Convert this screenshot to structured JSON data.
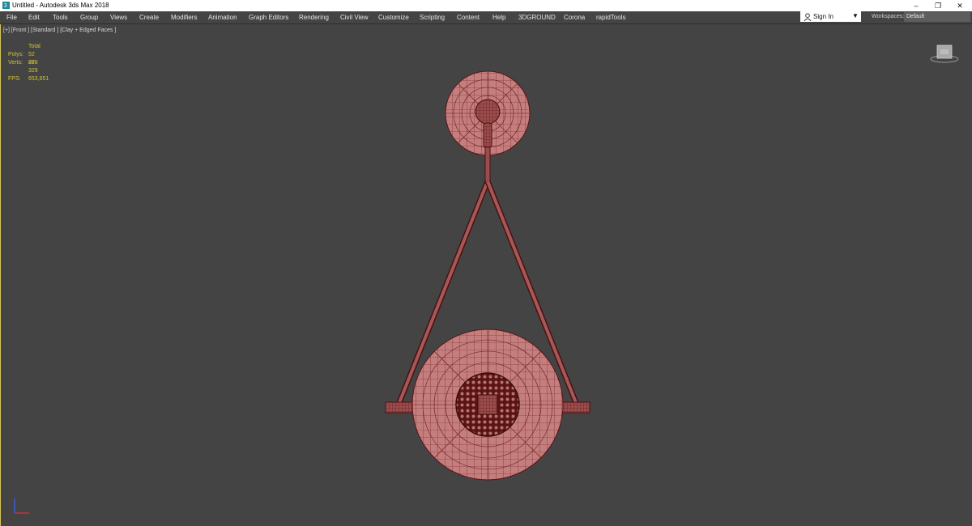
{
  "window": {
    "title": "Untitled - Autodesk 3ds Max 2018",
    "controls": {
      "minimize": "–",
      "restore": "❐",
      "close": "✕"
    }
  },
  "menu": {
    "items": [
      "File",
      "Edit",
      "Tools",
      "Group",
      "Views",
      "Create",
      "Modifiers",
      "Animation",
      "Graph Editors",
      "Rendering",
      "Civil View",
      "Customize",
      "Scripting",
      "Content",
      "Help",
      "3DGROUND",
      "Corona",
      "rapidTools"
    ]
  },
  "account": {
    "sign_in_label": "Sign In",
    "workspaces_label": "Workspaces:",
    "workspace_value": "Default"
  },
  "viewport": {
    "label": "[+] [Front ] [Standard ] [Clay + Edged Faces ]",
    "stats": {
      "header": "Total",
      "polys_label": "Polys:",
      "polys_value": "52 888",
      "verts_label": "Verts:",
      "verts_value": "27 329",
      "fps_label": "FPS:",
      "fps_value": "653,851"
    }
  },
  "colors": {
    "viewport_bg": "#444444",
    "stats_text": "#d2c233",
    "model_fill": "#bf7a7a",
    "model_wire": "#5a1414"
  },
  "icons": {
    "app": "3dsmax-app-icon",
    "user": "user-icon",
    "viewcube": "viewcube-icon",
    "axis": "axis-tripod-icon"
  }
}
